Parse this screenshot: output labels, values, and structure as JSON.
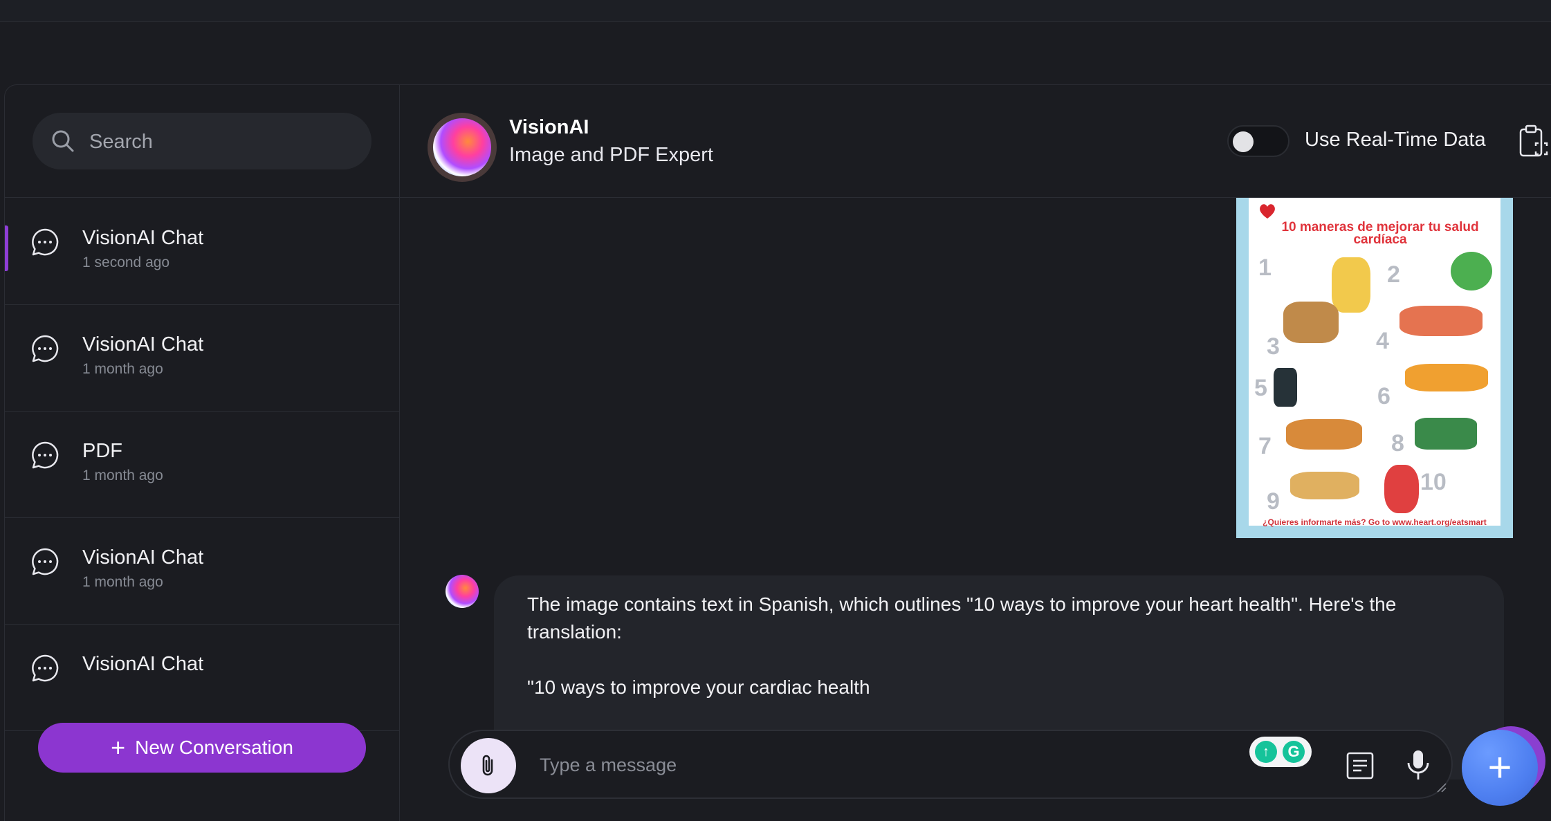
{
  "sidebar": {
    "search": {
      "placeholder": "Search"
    },
    "conversations": [
      {
        "title": "VisionAI Chat",
        "time": "1 second ago",
        "active": true
      },
      {
        "title": "VisionAI Chat",
        "time": "1 month ago"
      },
      {
        "title": "PDF",
        "time": "1 month ago"
      },
      {
        "title": "VisionAI Chat",
        "time": "1 month ago"
      },
      {
        "title": "VisionAI Chat",
        "time": ""
      }
    ],
    "new_conversation_label": "New Conversation"
  },
  "header": {
    "bot_name": "VisionAI",
    "bot_subtitle": "Image and PDF Expert",
    "realtime_label": "Use Real-Time Data",
    "realtime_enabled": false
  },
  "poster": {
    "title": "10 maneras de mejorar tu salud cardíaca",
    "numbers": [
      "1",
      "2",
      "3",
      "4",
      "5",
      "6",
      "7",
      "8",
      "9",
      "10"
    ],
    "footer": "¿Quieres informarte más? Go to www.heart.org/eatsmart"
  },
  "messages": [
    {
      "role": "assistant",
      "text": "The image contains text in Spanish, which outlines \"10 ways to improve your heart health\". Here's the translation:\n\n\"10 ways to improve your cardiac health"
    }
  ],
  "composer": {
    "placeholder": "Type a message"
  },
  "colors": {
    "accent": "#8c36d0",
    "fab": "#4e7ff0",
    "background": "#1b1c21"
  }
}
